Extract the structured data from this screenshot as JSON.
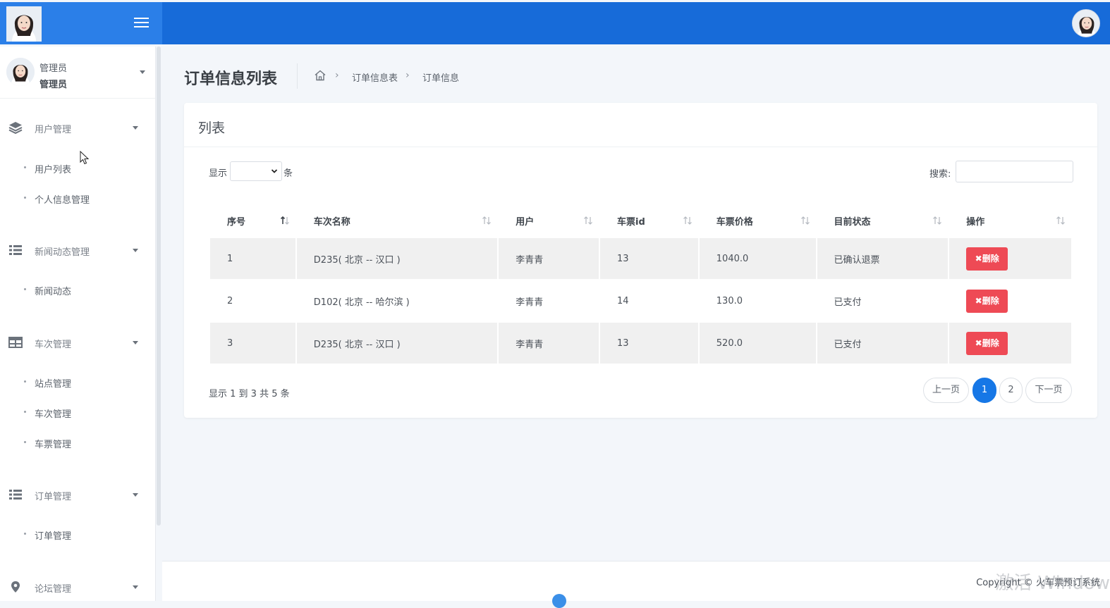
{
  "header": {
    "logo_icon": "user-avatar-icon",
    "menu_icon": "hamburger-icon",
    "profile_icon": "user-avatar-icon"
  },
  "sidebar": {
    "user": {
      "name": "管理员",
      "role": "管理员"
    },
    "groups": [
      {
        "label": "用户管理",
        "icon": "layers-icon",
        "items": [
          "用户列表",
          "个人信息管理"
        ]
      },
      {
        "label": "新闻动态管理",
        "icon": "list-icon",
        "items": [
          "新闻动态"
        ]
      },
      {
        "label": "车次管理",
        "icon": "table-icon",
        "items": [
          "站点管理",
          "车次管理",
          "车票管理"
        ]
      },
      {
        "label": "订单管理",
        "icon": "list-icon",
        "items": [
          "订单管理"
        ]
      },
      {
        "label": "论坛管理",
        "icon": "map-pin-icon",
        "items": []
      }
    ]
  },
  "page": {
    "title": "订单信息列表",
    "breadcrumb": [
      "订单信息表",
      "订单信息"
    ]
  },
  "card": {
    "title": "列表",
    "length_prefix": "显示",
    "length_suffix": "条",
    "length_value": "",
    "search_label": "搜索:",
    "search_value": "",
    "columns": [
      "序号",
      "车次名称",
      "用户",
      "车票id",
      "车票价格",
      "目前状态",
      "操作"
    ],
    "rows": [
      {
        "no": "1",
        "train": "D235( 北京 -- 汉口 )",
        "user": "李青青",
        "ticket_id": "13",
        "price": "1040.0",
        "status": "已确认退票",
        "action": "✖删除"
      },
      {
        "no": "2",
        "train": "D102( 北京 -- 哈尔滨 )",
        "user": "李青青",
        "ticket_id": "14",
        "price": "130.0",
        "status": "已支付",
        "action": "✖删除"
      },
      {
        "no": "3",
        "train": "D235( 北京 -- 汉口 )",
        "user": "李青青",
        "ticket_id": "13",
        "price": "520.0",
        "status": "已支付",
        "action": "✖删除"
      }
    ],
    "info": "显示 1 到 3 共 5 条",
    "pagination": {
      "prev": "上一页",
      "pages": [
        "1",
        "2"
      ],
      "current": "1",
      "next": "下一页"
    }
  },
  "footer": {
    "copyright": "Copyright © 火车票预订系统",
    "watermark": "激活 Window"
  },
  "colors": {
    "topbar": "#176bd9",
    "topbar_left": "#2b7fe8",
    "delete_button": "#ee4a55",
    "page_active": "#1677e6"
  }
}
